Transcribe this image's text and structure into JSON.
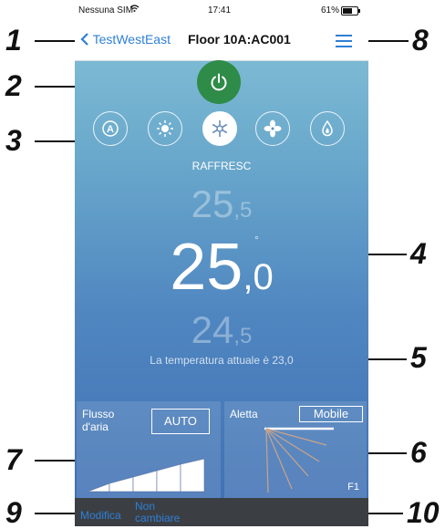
{
  "status_bar": {
    "carrier": "Nessuna SIM",
    "time": "17:41",
    "battery": "61%"
  },
  "nav": {
    "back_label": "TestWestEast",
    "title": "Floor 10A:AC001"
  },
  "modes": {
    "items": [
      {
        "name": "auto",
        "icon": "auto-mode-icon"
      },
      {
        "name": "heat",
        "icon": "sun-icon"
      },
      {
        "name": "cool",
        "icon": "snowflake-icon"
      },
      {
        "name": "fan",
        "icon": "fan-icon"
      },
      {
        "name": "dry",
        "icon": "droplet-icon"
      }
    ],
    "active_index": 2,
    "active_label": "RAFFRESC"
  },
  "temperature": {
    "upper_int": "25",
    "upper_dec": ",5",
    "set_int": "25",
    "set_dec": ",0",
    "degree_mark": "°",
    "lower_int": "24",
    "lower_dec": ",5",
    "current_text": "La temperatura attuale è 23,0"
  },
  "airflow": {
    "title_line1": "Flusso",
    "title_line2": "d'aria",
    "mode_label": "AUTO",
    "levels": 5,
    "level": 5
  },
  "louver": {
    "title": "Aletta",
    "mode_label": "Mobile",
    "code": "F1"
  },
  "footer": {
    "edit_label": "Modifica",
    "nochange_line1": "Non",
    "nochange_line2": "cambiare"
  },
  "callouts": [
    "1",
    "2",
    "3",
    "4",
    "5",
    "6",
    "7",
    "8",
    "9",
    "10"
  ],
  "colors": {
    "accent": "#2f7fd6",
    "power": "#2e8b48",
    "louver_lines": "#c9a48a"
  }
}
